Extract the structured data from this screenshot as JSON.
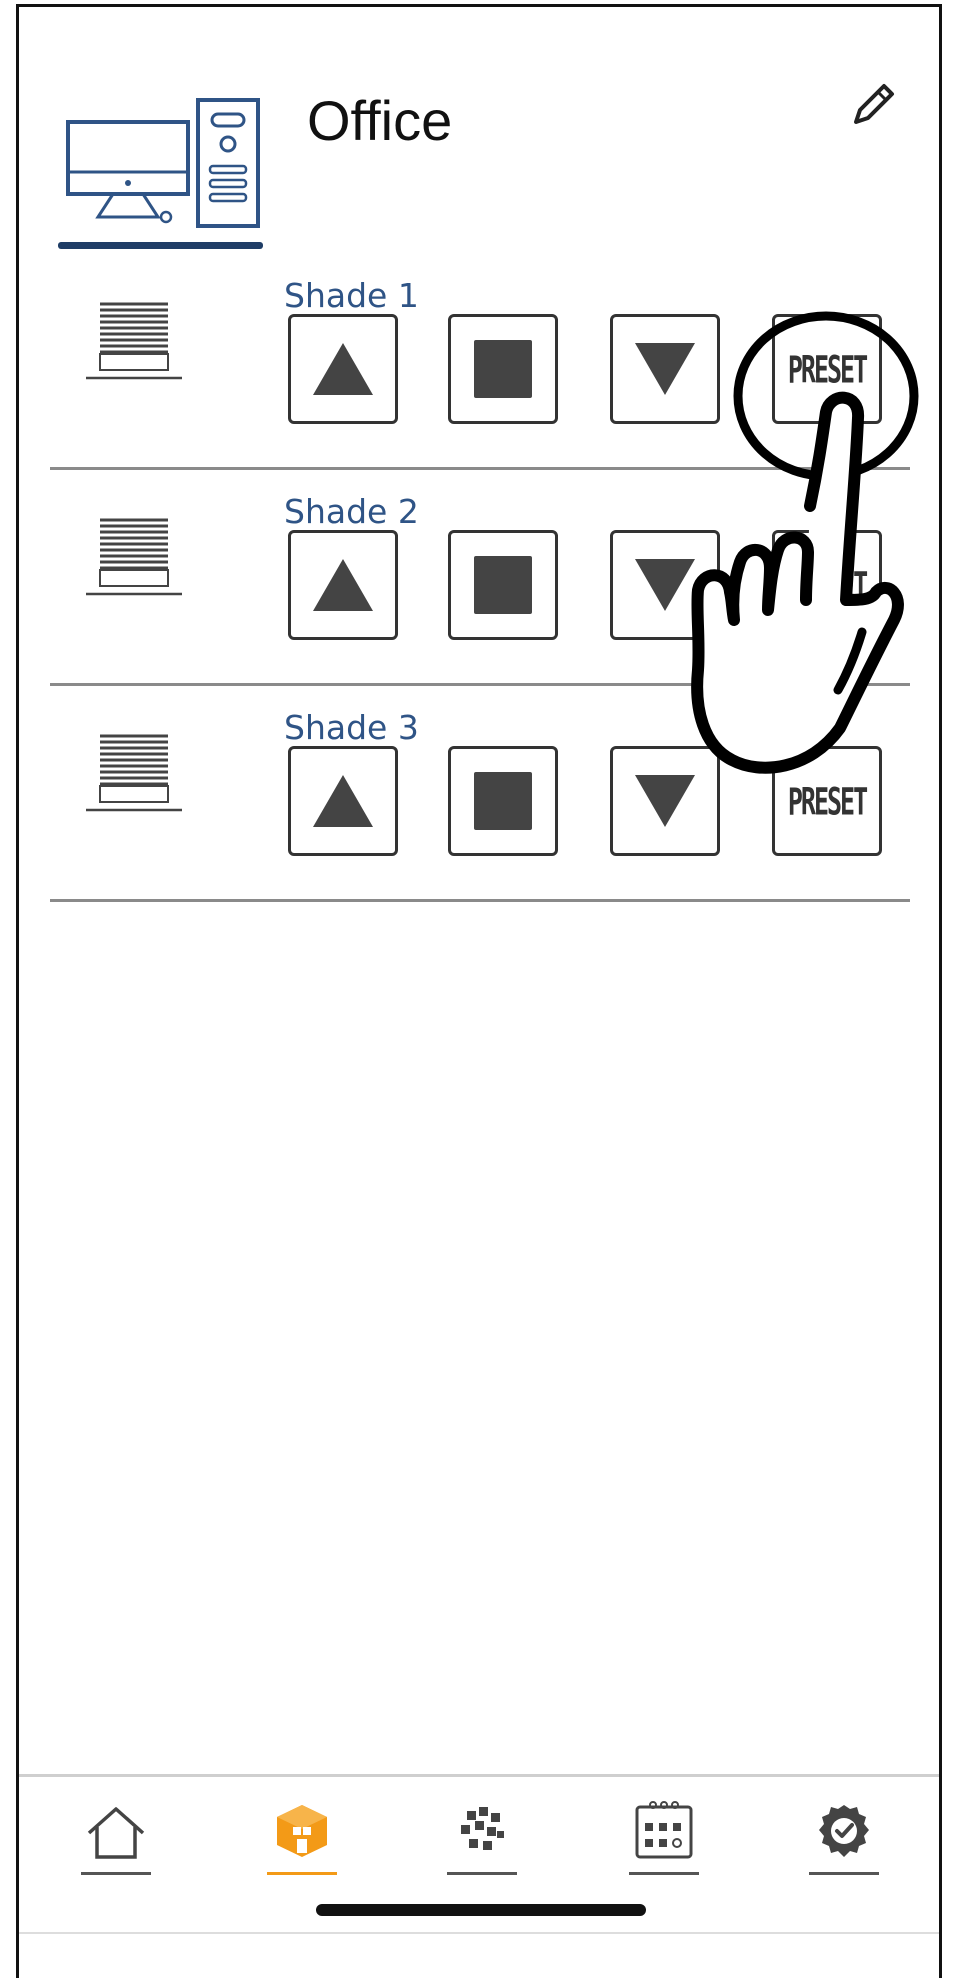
{
  "header": {
    "room_title": "Office",
    "room_icon": "computer-icon",
    "edit_icon": "pencil-icon"
  },
  "shades": [
    {
      "label": "Shade 1",
      "preset_label": "PRESET"
    },
    {
      "label": "Shade 2",
      "preset_label": "PRESET"
    },
    {
      "label": "Shade 3",
      "preset_label": "PRESET"
    }
  ],
  "nav": {
    "items": [
      {
        "icon": "home-icon"
      },
      {
        "icon": "room-cube-icon"
      },
      {
        "icon": "scenes-grid-icon"
      },
      {
        "icon": "calendar-icon"
      },
      {
        "icon": "settings-gear-icon"
      }
    ],
    "active_index": 1,
    "active_color": "#f39a17"
  },
  "colors": {
    "label_blue": "#2f5486",
    "icon_blue": "#2f5486",
    "button_dark": "#444444"
  }
}
